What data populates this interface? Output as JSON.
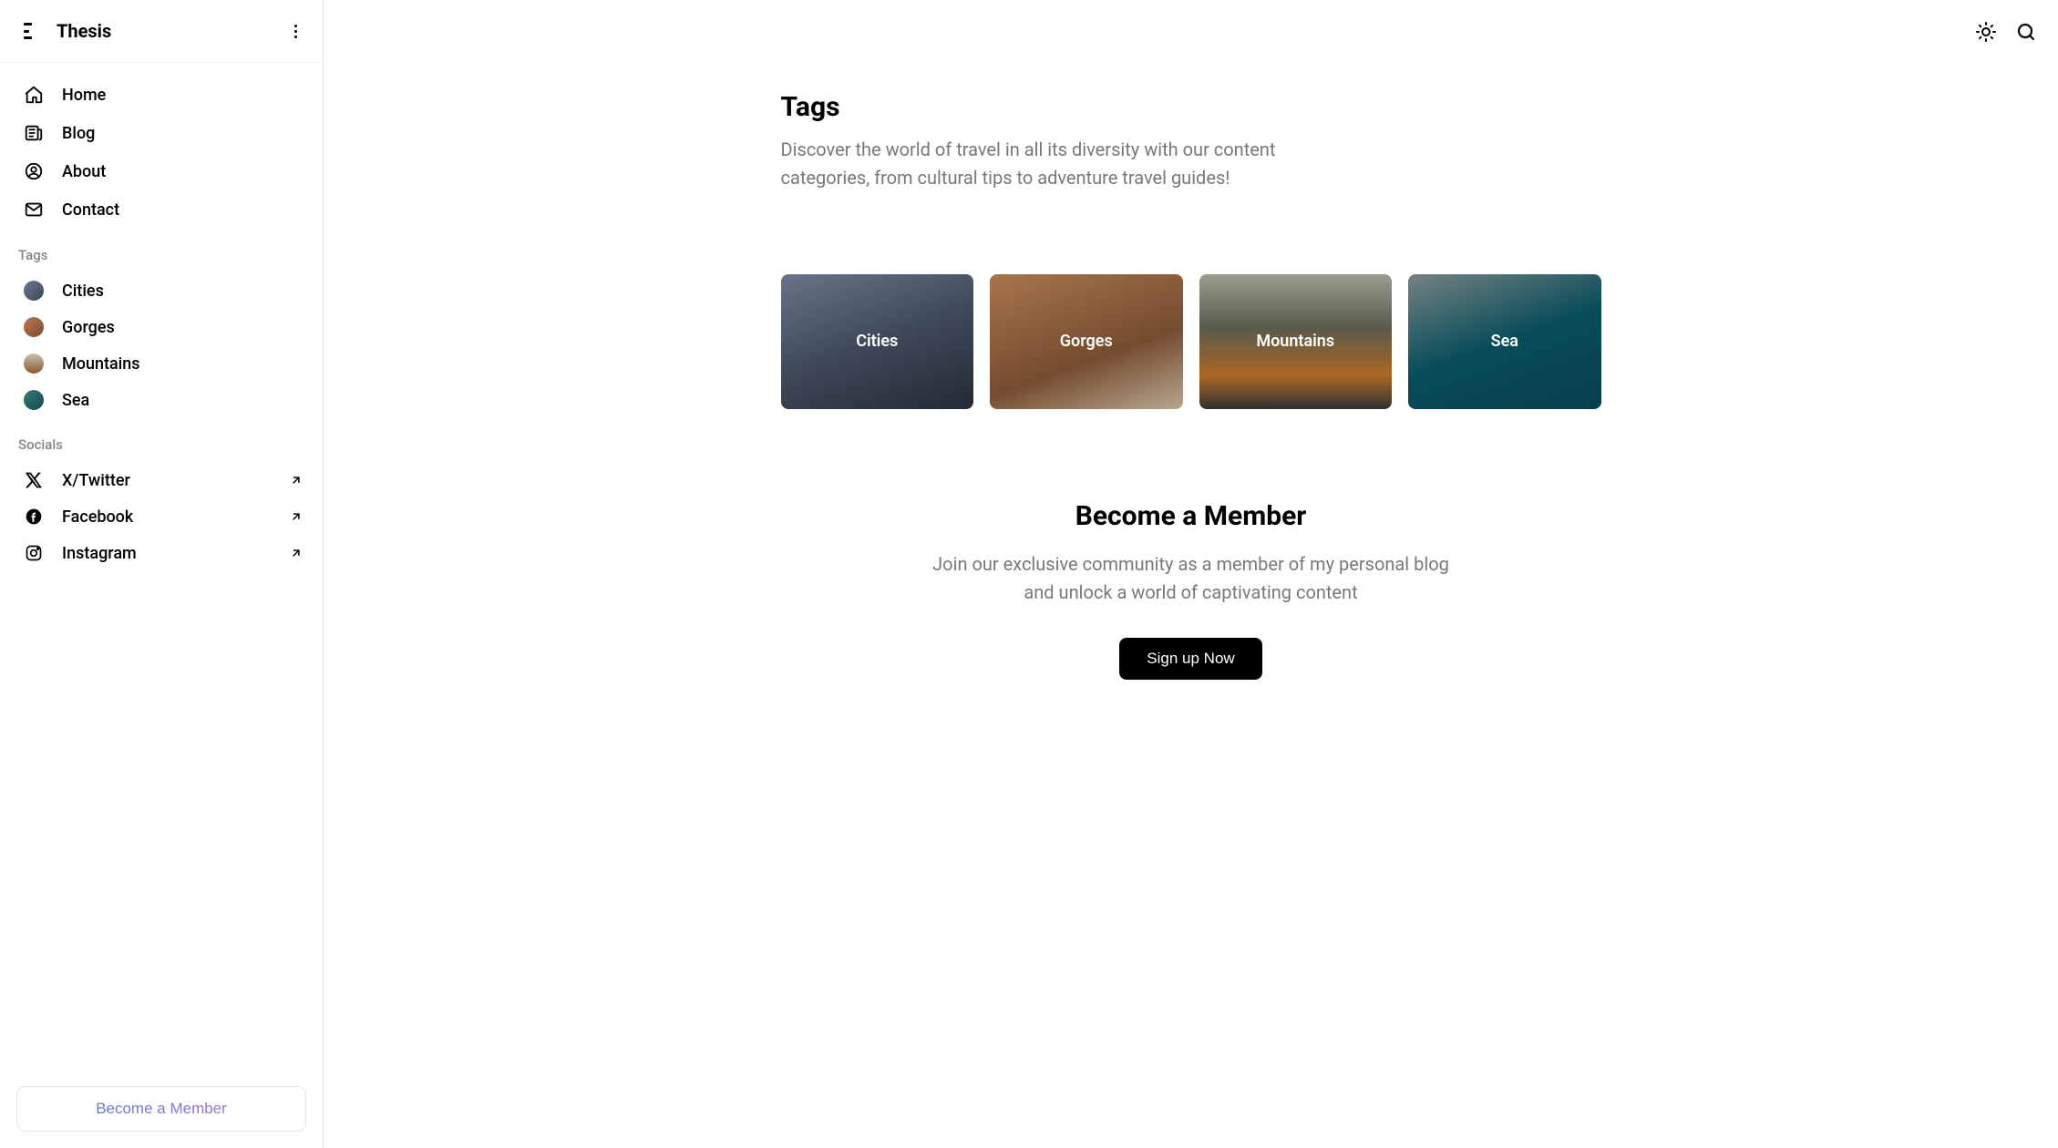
{
  "site": {
    "title": "Thesis"
  },
  "nav": [
    {
      "label": "Home"
    },
    {
      "label": "Blog"
    },
    {
      "label": "About"
    },
    {
      "label": "Contact"
    }
  ],
  "sections": {
    "tags_label": "Tags",
    "socials_label": "Socials"
  },
  "tags": [
    {
      "label": "Cities",
      "gradient": "linear-gradient(135deg,#6b7a8f,#3a4556)"
    },
    {
      "label": "Gorges",
      "gradient": "linear-gradient(135deg,#b97a56,#7a4a2e)"
    },
    {
      "label": "Mountains",
      "gradient": "linear-gradient(180deg,#c9bfae,#8a5a2e)"
    },
    {
      "label": "Sea",
      "gradient": "linear-gradient(135deg,#3a7a7a,#0f4a4f)"
    }
  ],
  "socials": [
    {
      "label": "X/Twitter"
    },
    {
      "label": "Facebook"
    },
    {
      "label": "Instagram"
    }
  ],
  "sidebar_cta": {
    "label": "Become a Member"
  },
  "page": {
    "title": "Tags",
    "subtitle": "Discover the world of travel in all its diversity with our content categories, from cultural tips to adventure travel guides!"
  },
  "cards": [
    {
      "label": "Cities",
      "bg": "linear-gradient(160deg,#7a8aa0 0%,#4a5668 50%,#2a3240 100%)"
    },
    {
      "label": "Gorges",
      "bg": "linear-gradient(160deg,#c48a5a 0%,#8a5a38 60%,#d8c4a8 100%)"
    },
    {
      "label": "Mountains",
      "bg": "linear-gradient(180deg,#b8b8a8 0%,#6a6a5a 40%,#c87a2a 75%,#3a3a3a 100%)"
    },
    {
      "label": "Sea",
      "bg": "linear-gradient(160deg,#8a9a9a 0%,#0a5a6a 50%,#0a4a5a 100%)"
    }
  ],
  "cta": {
    "title": "Become a Member",
    "text": "Join our exclusive community as a member of my personal blog and unlock a world of captivating content",
    "button": "Sign up Now"
  }
}
